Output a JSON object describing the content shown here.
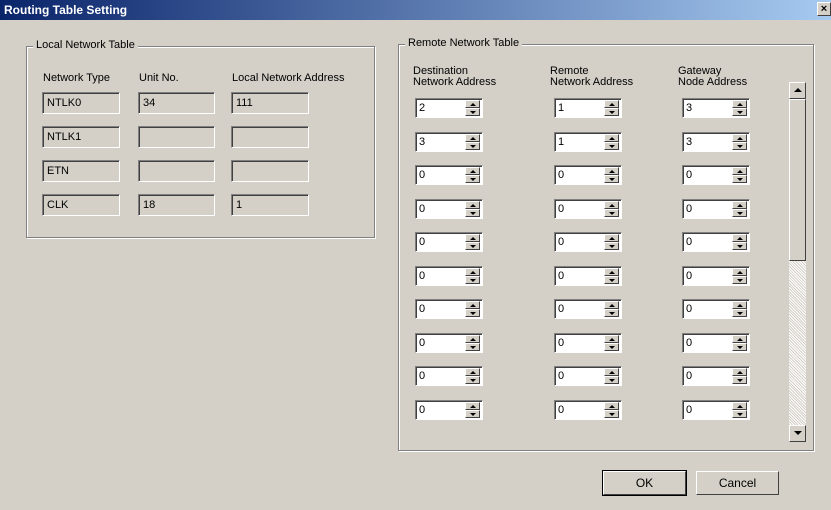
{
  "window": {
    "title": "Routing Table Setting",
    "close_glyph": "×"
  },
  "local": {
    "legend": "Local Network Table",
    "headers": {
      "network_type": "Network Type",
      "unit_no": "Unit No.",
      "local_address": "Local Network Address"
    },
    "rows": [
      {
        "type": "NTLK0",
        "unit": "34",
        "address": "111"
      },
      {
        "type": "NTLK1",
        "unit": "",
        "address": ""
      },
      {
        "type": "ETN",
        "unit": "",
        "address": ""
      },
      {
        "type": "CLK",
        "unit": "18",
        "address": "1"
      }
    ]
  },
  "remote": {
    "legend": "Remote Network Table",
    "headers": {
      "destination_1": "Destination",
      "destination_2": "Network Address",
      "remote_1": "Remote",
      "remote_2": "Network Address",
      "gateway_1": "Gateway",
      "gateway_2": "Node Address"
    },
    "rows": [
      {
        "dest": "2",
        "remote": "1",
        "gateway": "3"
      },
      {
        "dest": "3",
        "remote": "1",
        "gateway": "3"
      },
      {
        "dest": "0",
        "remote": "0",
        "gateway": "0"
      },
      {
        "dest": "0",
        "remote": "0",
        "gateway": "0"
      },
      {
        "dest": "0",
        "remote": "0",
        "gateway": "0"
      },
      {
        "dest": "0",
        "remote": "0",
        "gateway": "0"
      },
      {
        "dest": "0",
        "remote": "0",
        "gateway": "0"
      },
      {
        "dest": "0",
        "remote": "0",
        "gateway": "0"
      },
      {
        "dest": "0",
        "remote": "0",
        "gateway": "0"
      },
      {
        "dest": "0",
        "remote": "0",
        "gateway": "0"
      }
    ]
  },
  "buttons": {
    "ok": "OK",
    "cancel": "Cancel"
  }
}
